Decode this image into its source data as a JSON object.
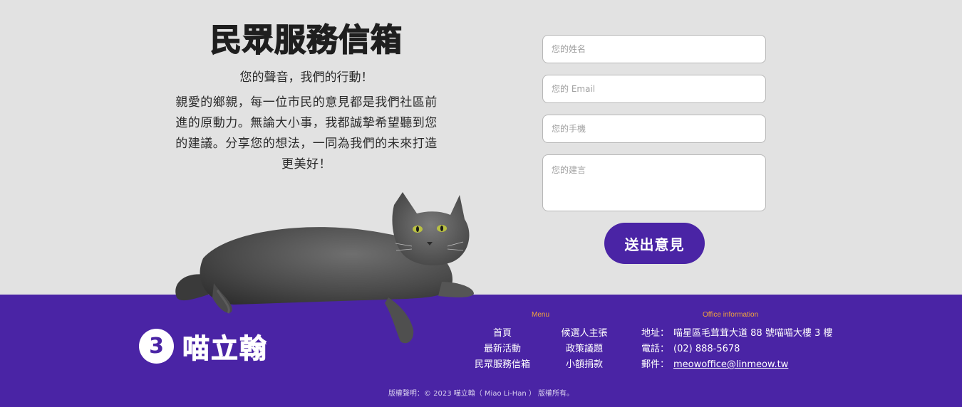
{
  "intro": {
    "title": "民眾服務信箱",
    "subtitle": "您的聲音，我們的行動！",
    "body": "親愛的鄉親，每一位市民的意見都是我們社區前進的原動力。無論大小事，我都誠摯希望聽到您的建議。分享您的想法，一同為我們的未來打造更美好！"
  },
  "form": {
    "name_placeholder": "您的姓名",
    "email_placeholder": "您的 Email",
    "phone_placeholder": "您的手機",
    "suggestion_placeholder": "您的建言",
    "submit_label": "送出意見"
  },
  "footer": {
    "logo_number": "3",
    "logo_name": "喵立翰",
    "menu_title": "Menu",
    "menu_col1": [
      "首頁",
      "最新活動",
      "民眾服務信箱"
    ],
    "menu_col2": [
      "候選人主張",
      "政策議題",
      "小額捐款"
    ],
    "office_title": "Office information",
    "address_label": "地址：",
    "address_value": "喵星區毛茸茸大道 88 號喵喵大樓 3 樓",
    "phone_label": "電話：",
    "phone_value": "(02) 888-5678",
    "email_label": "郵件：",
    "email_value": "meowoffice@linmeow.tw",
    "copyright": "版權聲明：© 2023 喵立翰（ Miao Li-Han ） 版權所有。"
  },
  "colors": {
    "brand_purple": "#4a24a5",
    "accent_orange": "#f2a43c",
    "background": "#e2e2e2"
  },
  "icons": {
    "cat_image": "cat-illustration"
  }
}
